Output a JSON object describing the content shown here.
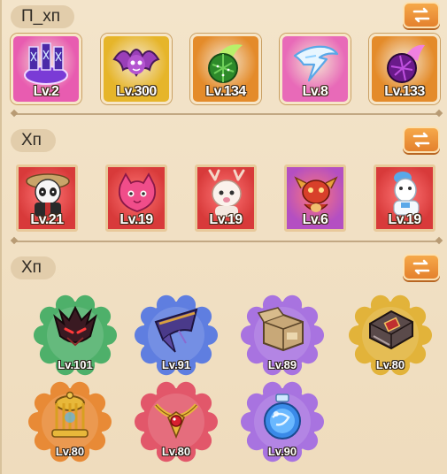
{
  "sections": [
    {
      "title": "П_хп"
    },
    {
      "title": "Хп"
    },
    {
      "title": "Хп"
    }
  ],
  "swap_icon": "swap-arrows-icon",
  "skills": [
    {
      "icon": "rune-gate-icon",
      "level": "Lv.2",
      "bg": "#e85cb0"
    },
    {
      "icon": "bat-icon",
      "level": "Lv.300",
      "bg": "#e6b52a"
    },
    {
      "icon": "cactus-orb-icon",
      "level": "Lv.134",
      "bg": "#e48b2a"
    },
    {
      "icon": "lightning-bolt-icon",
      "level": "Lv.8",
      "bg": "#e86ab8"
    },
    {
      "icon": "dark-orb-icon",
      "level": "Lv.133",
      "bg": "#e48b2a"
    }
  ],
  "pets": [
    {
      "icon": "panda-samurai-icon",
      "level": "Lv.21",
      "bg": "#d83a3a"
    },
    {
      "icon": "pink-slime-cat-icon",
      "level": "Lv.19",
      "bg": "#d83a3a"
    },
    {
      "icon": "white-deer-icon",
      "level": "Lv.19",
      "bg": "#d83a3a"
    },
    {
      "icon": "red-dragon-icon",
      "level": "Lv.6",
      "bg": "#b44fc2"
    },
    {
      "icon": "alpaca-icon",
      "level": "Lv.19",
      "bg": "#d83a3a"
    }
  ],
  "gear": [
    {
      "icon": "demon-helmet-icon",
      "level": "Lv.101",
      "bg": "#4eb06a"
    },
    {
      "icon": "witch-hat-icon",
      "level": "Lv.91",
      "bg": "#5f7ee0"
    },
    {
      "icon": "cardboard-box-icon",
      "level": "Lv.89",
      "bg": "#a873e0"
    },
    {
      "icon": "spellbook-icon",
      "level": "Lv.80",
      "bg": "#e2b33a"
    },
    {
      "icon": "golden-cage-icon",
      "level": "Lv.80",
      "bg": "#e88a36"
    },
    {
      "icon": "ruby-necklace-icon",
      "level": "Lv.80",
      "bg": "#e2576a"
    },
    {
      "icon": "crystal-orb-icon",
      "level": "Lv.90",
      "bg": "#a873e0"
    }
  ]
}
